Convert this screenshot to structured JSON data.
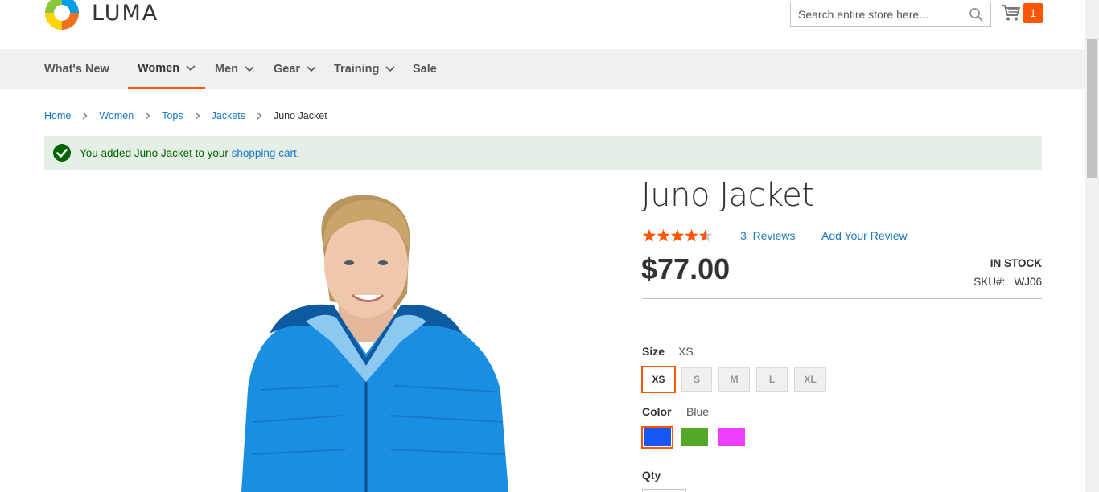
{
  "header": {
    "logo_text": "LUMA",
    "search_placeholder": "Search entire store here...",
    "cart_count": "1"
  },
  "nav": {
    "items": [
      {
        "label": "What's New",
        "has_dropdown": false,
        "active": false
      },
      {
        "label": "Women",
        "has_dropdown": true,
        "active": true
      },
      {
        "label": "Men",
        "has_dropdown": true,
        "active": false
      },
      {
        "label": "Gear",
        "has_dropdown": true,
        "active": false
      },
      {
        "label": "Training",
        "has_dropdown": true,
        "active": false
      },
      {
        "label": "Sale",
        "has_dropdown": false,
        "active": false
      }
    ]
  },
  "breadcrumb": {
    "items": [
      "Home",
      "Women",
      "Tops",
      "Jackets"
    ],
    "current": "Juno Jacket"
  },
  "message": {
    "text_before": "You added Juno Jacket to your ",
    "link_text": "shopping cart",
    "text_after": "."
  },
  "product": {
    "title": "Juno Jacket",
    "rating_fraction": 0.9,
    "reviews_count": "3",
    "reviews_label": "Reviews",
    "add_review_label": "Add Your Review",
    "price": "$77.00",
    "stock": "IN STOCK",
    "sku_label": "SKU#:",
    "sku_value": "WJ06"
  },
  "options": {
    "size_label": "Size",
    "size_selected": "XS",
    "sizes": [
      "XS",
      "S",
      "M",
      "L",
      "XL"
    ],
    "color_label": "Color",
    "color_selected": "Blue",
    "colors": [
      {
        "name": "Blue",
        "hex": "#1857f7"
      },
      {
        "name": "Green",
        "hex": "#53a828"
      },
      {
        "name": "Purple",
        "hex": "#ef3dff"
      }
    ],
    "qty_label": "Qty"
  },
  "colors": {
    "accent": "#ff5501",
    "link": "#1979c3",
    "success_bg": "#e5efe5",
    "success_text": "#006400"
  }
}
